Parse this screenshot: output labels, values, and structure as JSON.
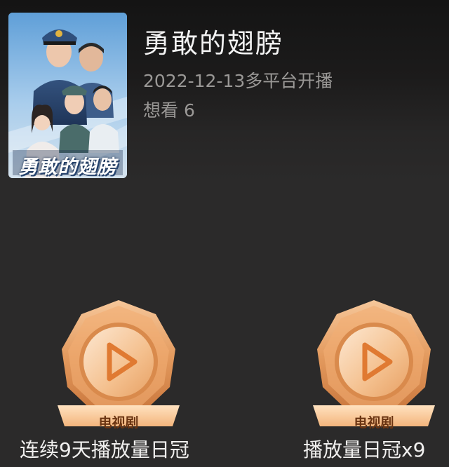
{
  "show": {
    "title": "勇敢的翅膀",
    "poster_title": "勇敢的翅膀",
    "release": "2022-12-13多平台开播",
    "want_to_watch": "想看 6"
  },
  "badges": [
    {
      "tag": "电视剧",
      "caption": "连续9天播放量日冠",
      "icon": "play-icon"
    },
    {
      "tag": "电视剧",
      "caption": "播放量日冠x9",
      "icon": "play-icon"
    }
  ],
  "colors": {
    "background": "#2b2a2a",
    "title_text": "#f2f2f2",
    "meta_text": "#9a9896",
    "badge_bronze": "#e3a06a",
    "badge_tag_text": "#6a3412"
  }
}
